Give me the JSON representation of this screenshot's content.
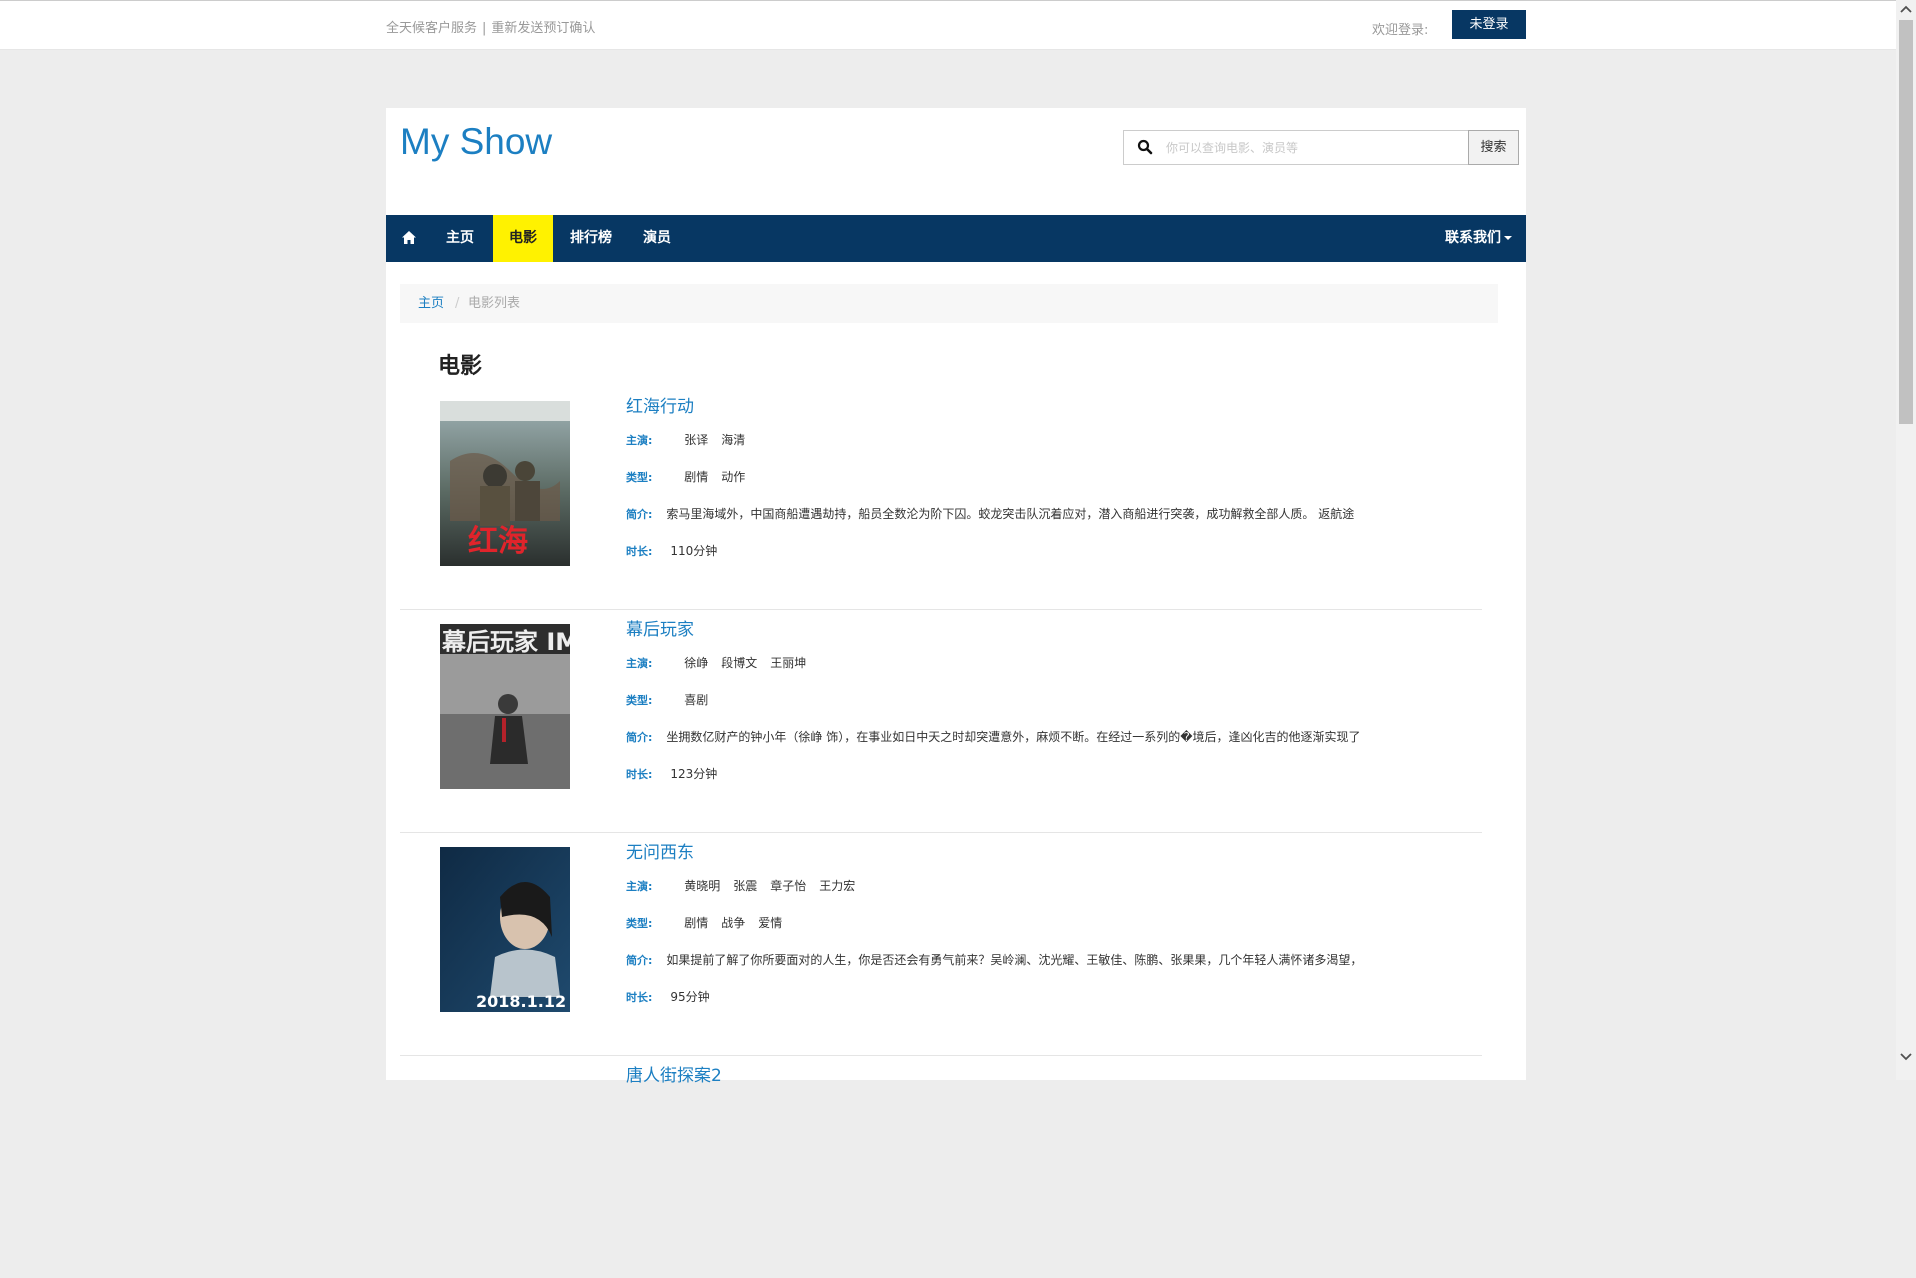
{
  "topbar": {
    "service_link": "全天候客户服务",
    "separator": "|",
    "resend_link": "重新发送预订确认",
    "welcome": "欢迎登录:",
    "login_button": "未登录"
  },
  "header": {
    "brand": "My Show",
    "search_placeholder": "你可以查询电影、演员等",
    "search_button": "搜索"
  },
  "nav": {
    "items": [
      {
        "label": "主页",
        "active": false
      },
      {
        "label": "电影",
        "active": true
      },
      {
        "label": "排行榜",
        "active": false
      },
      {
        "label": "演员",
        "active": false
      }
    ],
    "contact": "联系我们",
    "active_color": "#fff200",
    "bg_color": "#073763"
  },
  "breadcrumb": {
    "home": "主页",
    "divider": "/",
    "current": "电影列表"
  },
  "page_heading": "电影",
  "labels": {
    "cast": "主演:",
    "genre": "类型:",
    "intro": "简介:",
    "duration": "时长:"
  },
  "movies": [
    {
      "title": "红海行动",
      "cast": [
        "张译",
        "海清"
      ],
      "genres": [
        "剧情",
        "动作"
      ],
      "intro": "索马里海域外，中国商船遭遇劫持，船员全数沦为阶下囚。蛟龙突击队沉着应对，潜入商船进行突袭，成功解救全部人质。 返航途",
      "duration": "110分钟",
      "poster_text": "红海"
    },
    {
      "title": "幕后玩家",
      "cast": [
        "徐峥",
        "段博文",
        "王丽坤"
      ],
      "genres": [
        "喜剧"
      ],
      "intro": "坐拥数亿财产的钟小年（徐峥 饰），在事业如日中天之时却突遭意外，麻烦不断。在经过一系列的�境后，逢凶化吉的他逐渐实现了",
      "duration": "123分钟",
      "poster_text": "幕后玩家 IMAX"
    },
    {
      "title": "无问西东",
      "cast": [
        "黄晓明",
        "张震",
        "章子怡",
        "王力宏"
      ],
      "genres": [
        "剧情",
        "战争",
        "爱情"
      ],
      "intro": "如果提前了解了你所要面对的人生，你是否还会有勇气前来？吴岭澜、沈光耀、王敏佳、陈鹏、张果果，几个年轻人满怀诸多渴望，",
      "duration": "95分钟",
      "poster_text": "2018.1.12"
    },
    {
      "title": "唐人街探案2"
    }
  ]
}
